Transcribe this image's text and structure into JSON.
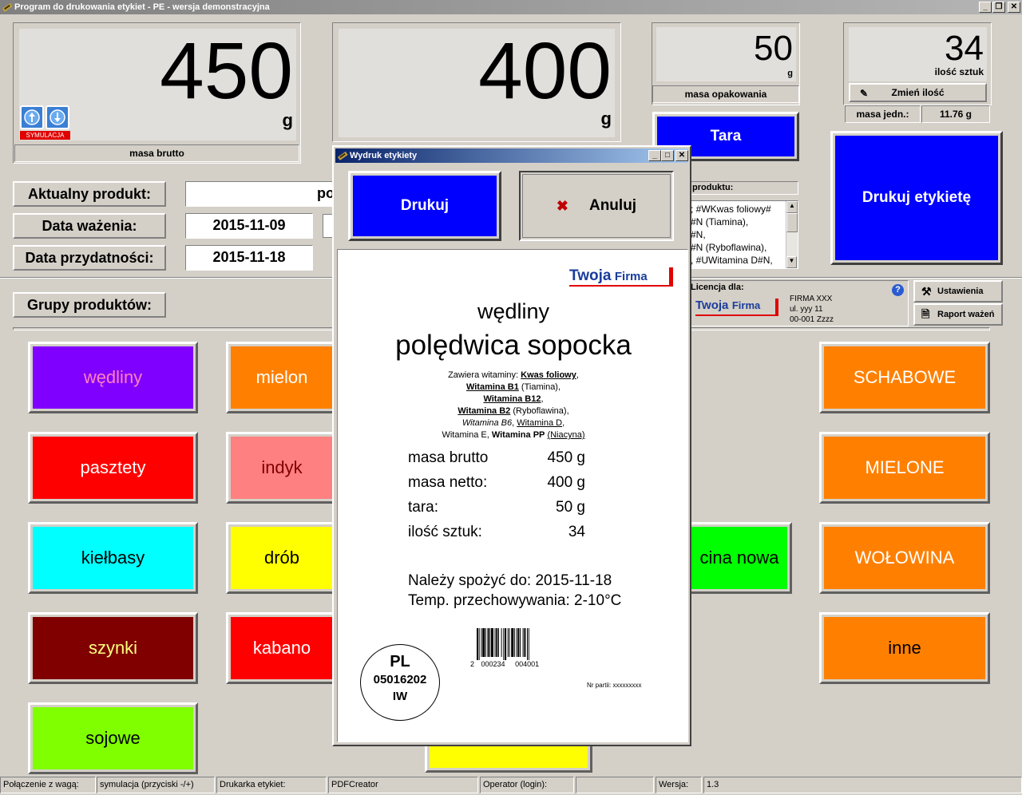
{
  "window": {
    "title": "Program do drukowania etykiet - PE - wersja demonstracyjna"
  },
  "scale_gross": {
    "value": "450",
    "unit": "g",
    "caption": "masa brutto",
    "sim_label": "SYMULACJA"
  },
  "scale_net": {
    "value": "400",
    "unit": "g"
  },
  "packaging": {
    "value": "50",
    "unit": "g",
    "caption": "masa opakowania"
  },
  "count": {
    "value": "34",
    "caption": "ilość sztuk",
    "change_label": "Zmień ilość",
    "unit_mass_label": "masa jedn.:",
    "unit_mass_value": "11.76 g"
  },
  "buttons": {
    "tara": "Tara",
    "print_label": "Drukuj etykietę",
    "settings": "Ustawienia",
    "report": "Raport ważeń"
  },
  "fields": {
    "current_product_label": "Aktualny produkt:",
    "current_product_value": "po",
    "weigh_date_label": "Data ważenia:",
    "weigh_date_value": "2015-11-09",
    "expiry_label": "Data przydatności:",
    "expiry_value": "2015-11-18"
  },
  "product_desc": {
    "label": "produktu:",
    "lines": [
      "; #WKwas foliowy#",
      "#N (Tiamina),",
      "#N,",
      "#N (Ryboflawina),",
      ", #UWitamina D#N,"
    ]
  },
  "license": {
    "label": "Licencja dla:",
    "line1": "FIRMA XXX",
    "line2": "ul. yyy 11",
    "line3": "00-001 Zzzz",
    "logo_a": "Twoja",
    "logo_b": "Firma"
  },
  "groups_label": "Grupy produktów:",
  "categories_left": [
    {
      "name": "wędliny",
      "bg": "#8000ff",
      "fg": "#ff80c0"
    },
    {
      "name": "pasztety",
      "bg": "#ff0000",
      "fg": "#ffffff"
    },
    {
      "name": "kiełbasy",
      "bg": "#00ffff",
      "fg": "#000000"
    },
    {
      "name": "szynki",
      "bg": "#800000",
      "fg": "#ffff80"
    },
    {
      "name": "sojowe",
      "bg": "#80ff00",
      "fg": "#000000"
    }
  ],
  "categories_mid": [
    {
      "name": "mielon",
      "bg": "#ff8000",
      "fg": "#ffffff"
    },
    {
      "name": "indyk",
      "bg": "#ff8080",
      "fg": "#800000"
    },
    {
      "name": "drób",
      "bg": "#ffff00",
      "fg": "#000000"
    },
    {
      "name": "kabano",
      "bg": "#ff0000",
      "fg": "#ffffff"
    }
  ],
  "category_partial": {
    "name": "cina nowa",
    "bg": "#00ff00",
    "fg": "#000000"
  },
  "categories_right": [
    {
      "name": "SCHABOWE",
      "bg": "#ff8000",
      "fg": "#ffffff"
    },
    {
      "name": "MIELONE",
      "bg": "#ff8000",
      "fg": "#ffffff"
    },
    {
      "name": "WOŁOWINA",
      "bg": "#ff8000",
      "fg": "#ffffff"
    },
    {
      "name": "inne",
      "bg": "#ff8000",
      "fg": "#000000"
    }
  ],
  "dialog": {
    "title": "Wydruk etykiety",
    "print": "Drukuj",
    "cancel": "Anuluj",
    "label": {
      "logo_a": "Twoja",
      "logo_b": "Firma",
      "group": "wędliny",
      "product": "polędwica sopocka",
      "n1": "Zawiera witaminy: ",
      "n1b": "Kwas foliowy",
      "n1c": ",",
      "n2b": "Witamina B1",
      "n2c": " (Tiamina),",
      "n3b": "Witamina B12",
      "n3c": ",",
      "n4b": "Witamina B2",
      "n4c": " (Ryboflawina),",
      "n5i": "Witamina B6",
      "n5u": "Witamina D",
      "n5sep": ", ",
      "n5c": ",",
      "n6a": "Witamina E, ",
      "n6b": "Witamina PP",
      "n6c": " (Niacyna)",
      "gross_label": "masa brutto",
      "gross_value": "450 g",
      "net_label": "masa netto:",
      "net_value": "400 g",
      "tare_label": "tara:",
      "tare_value": "50 g",
      "count_label": "ilość sztuk:",
      "count_value": "34",
      "best_before": "Należy spożyć do:  2015-11-18",
      "storage": "Temp. przechowywania: 2-10°C",
      "stamp_1": "PL",
      "stamp_2": "05016202",
      "stamp_3": "IW",
      "barcode_digits_a": "2",
      "barcode_digits_b": "000234",
      "barcode_digits_c": "004001",
      "batch": "Nr partii: xxxxxxxxx"
    }
  },
  "status": {
    "conn_label": "Połączenie z wagą:",
    "conn_value": "symulacja (przyciski -/+)",
    "printer_label": "Drukarka etykiet:",
    "printer_value": "PDFCreator",
    "operator_label": "Operator (login):",
    "operator_value": "",
    "version_label": "Wersja:",
    "version_value": "1.3"
  }
}
